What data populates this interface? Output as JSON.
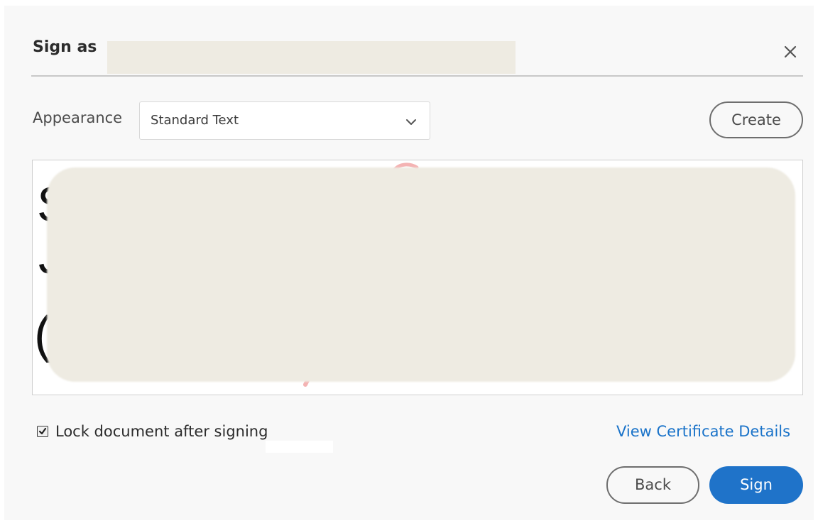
{
  "dialog": {
    "title": "Sign as",
    "close_icon": "close-icon"
  },
  "appearance": {
    "label": "Appearance",
    "selected": "Standard Text",
    "chevron_icon": "chevron-down-icon",
    "create_label": "Create"
  },
  "preview": {
    "visible_glyphs": [
      "S",
      "J",
      "("
    ]
  },
  "options": {
    "lock_label": "Lock document after signing",
    "lock_checked": true,
    "view_details_label": "View Certificate Details"
  },
  "actions": {
    "back_label": "Back",
    "sign_label": "Sign"
  },
  "colors": {
    "accent": "#1f73c9",
    "link": "#1a73c9",
    "redaction": "#eeebe2"
  }
}
